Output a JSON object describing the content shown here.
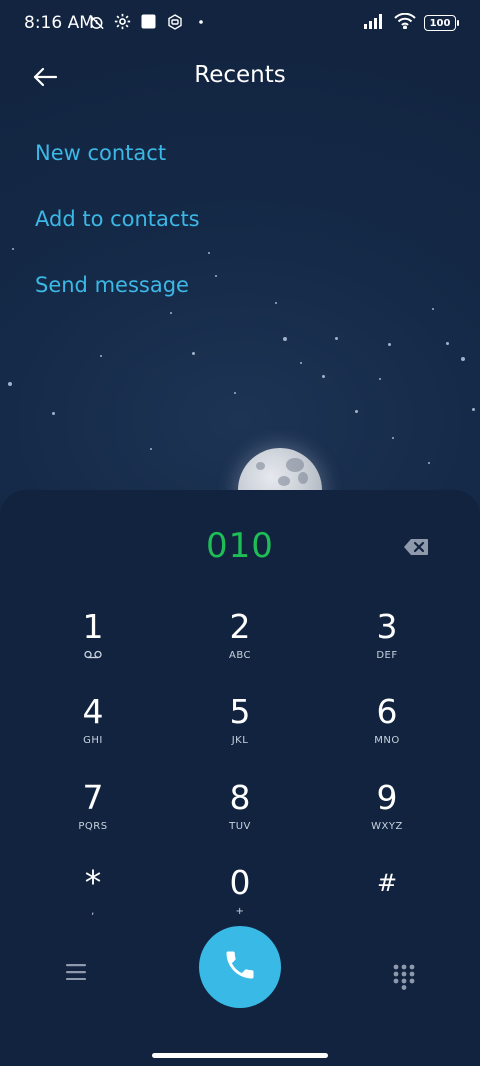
{
  "status_bar": {
    "time": "8:16 AM",
    "battery": "100",
    "icons": [
      "alarm-off-icon",
      "settings-icon",
      "square-icon",
      "mi-icon",
      "dot-icon",
      "signal-icon",
      "wifi-icon",
      "battery-icon"
    ]
  },
  "header": {
    "title": "Recents"
  },
  "menu": {
    "items": [
      "New contact",
      "Add to contacts",
      "Send message"
    ]
  },
  "dialer": {
    "number": "010",
    "keys": [
      {
        "digit": "1",
        "letters": ""
      },
      {
        "digit": "2",
        "letters": "ABC"
      },
      {
        "digit": "3",
        "letters": "DEF"
      },
      {
        "digit": "4",
        "letters": "GHI"
      },
      {
        "digit": "5",
        "letters": "JKL"
      },
      {
        "digit": "6",
        "letters": "MNO"
      },
      {
        "digit": "7",
        "letters": "PQRS"
      },
      {
        "digit": "8",
        "letters": "TUV"
      },
      {
        "digit": "9",
        "letters": "WXYZ"
      },
      {
        "digit": "*",
        "letters": ","
      },
      {
        "digit": "0",
        "letters": "+"
      },
      {
        "digit": "#",
        "letters": ""
      }
    ]
  },
  "colors": {
    "accent": "#3cb8e6",
    "number": "#1fbd55",
    "call_button": "#38b9e6",
    "background": "#132440"
  }
}
